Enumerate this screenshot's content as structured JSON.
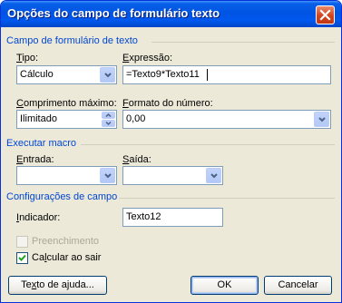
{
  "window": {
    "title": "Opções do campo de formulário texto"
  },
  "groups": {
    "field": "Campo de formulário de texto",
    "macro": "Executar macro",
    "settings": "Configurações de campo"
  },
  "type": {
    "label_u": "T",
    "label_rest": "ipo:",
    "value": "Cálculo"
  },
  "expression": {
    "label_u": "E",
    "label_rest": "xpressão:",
    "value": "=Texto9*Texto11"
  },
  "max_length": {
    "label_u": "C",
    "label_rest": "omprimento máximo:",
    "value": "Ilimitado"
  },
  "number_format": {
    "label_u": "F",
    "label_rest": "ormato do número:",
    "value": "0,00"
  },
  "entry": {
    "label_u": "E",
    "label_rest": "ntrada:",
    "value": ""
  },
  "exit": {
    "label_u": "S",
    "label_rest": "aída:",
    "value": ""
  },
  "bookmark": {
    "label_u": "I",
    "label_rest": "ndicador:",
    "value": "Texto12"
  },
  "fill_in": {
    "label": "Preenchimento",
    "checked": false,
    "enabled": false
  },
  "calc_on_exit": {
    "label_u": "l",
    "label_pre": "Ca",
    "label_rest": "cular ao sair",
    "checked": true
  },
  "buttons": {
    "help_pre": "Te",
    "help_u": "x",
    "help_rest": "to de ajuda...",
    "ok": "OK",
    "cancel": "Cancelar"
  }
}
